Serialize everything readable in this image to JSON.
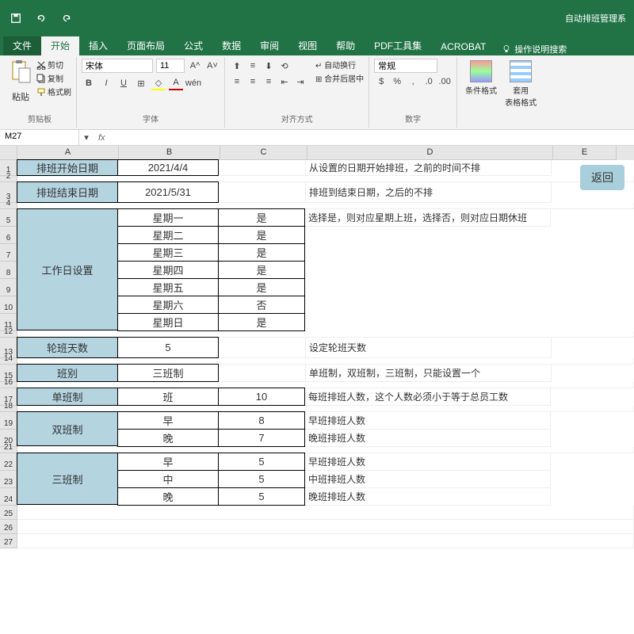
{
  "window_title": "自动排班管理系",
  "tabs": {
    "file": "文件",
    "home": "开始",
    "insert": "插入",
    "layout": "页面布局",
    "formulas": "公式",
    "data": "数据",
    "review": "审阅",
    "view": "视图",
    "help": "帮助",
    "pdf": "PDF工具集",
    "acrobat": "ACROBAT",
    "tellme": "操作说明搜索"
  },
  "ribbon": {
    "paste": "粘贴",
    "cut": "剪切",
    "copy": "复制",
    "fmtpaint": "格式刷",
    "clipboard": "剪贴板",
    "font_name": "宋体",
    "font_size": "11",
    "font": "字体",
    "wraptext": "自动换行",
    "merge": "合并后居中",
    "alignment": "对齐方式",
    "numberfmt": "常规",
    "number": "数字",
    "condfmt": "条件格式",
    "tablefmt": "套用\n表格格式"
  },
  "namebox": "M27",
  "cols": {
    "A": "A",
    "B": "B",
    "C": "C",
    "D": "D",
    "E": "E"
  },
  "grid": {
    "r1": {
      "A": "排班开始日期",
      "B": "2021/4/4",
      "D": "从设置的日期开始排班，之前的时间不排"
    },
    "r3": {
      "A": "排班结束日期",
      "B": "2021/5/31",
      "D": "排班到结束日期，之后的不排"
    },
    "r5": {
      "A": "工作日设置",
      "B": "星期一",
      "C": "是",
      "D": "选择是，则对应星期上班，选择否，则对应日期休班"
    },
    "r6": {
      "B": "星期二",
      "C": "是"
    },
    "r7": {
      "B": "星期三",
      "C": "是"
    },
    "r8": {
      "B": "星期四",
      "C": "是"
    },
    "r9": {
      "B": "星期五",
      "C": "是"
    },
    "r10": {
      "B": "星期六",
      "C": "否"
    },
    "r11": {
      "B": "星期日",
      "C": "是"
    },
    "r13": {
      "A": "轮班天数",
      "B": "5",
      "D": "设定轮班天数"
    },
    "r15": {
      "A": "班别",
      "B": "三班制",
      "D": "单班制，双班制，三班制，只能设置一个"
    },
    "r17": {
      "A": "单班制",
      "B": "班",
      "C": "10",
      "D": "每班排班人数，这个人数必须小于等于总员工数"
    },
    "r19": {
      "A": "双班制",
      "B": "早",
      "C": "8",
      "D": "早班排班人数"
    },
    "r20": {
      "B": "晚",
      "C": "7",
      "D": "晚班排班人数"
    },
    "r22": {
      "A": "三班制",
      "B": "早",
      "C": "5",
      "D": "早班排班人数"
    },
    "r23": {
      "B": "中",
      "C": "5",
      "D": "中班排班人数"
    },
    "r24": {
      "B": "晚",
      "C": "5",
      "D": "晚班排班人数"
    }
  },
  "return_btn": "返回"
}
